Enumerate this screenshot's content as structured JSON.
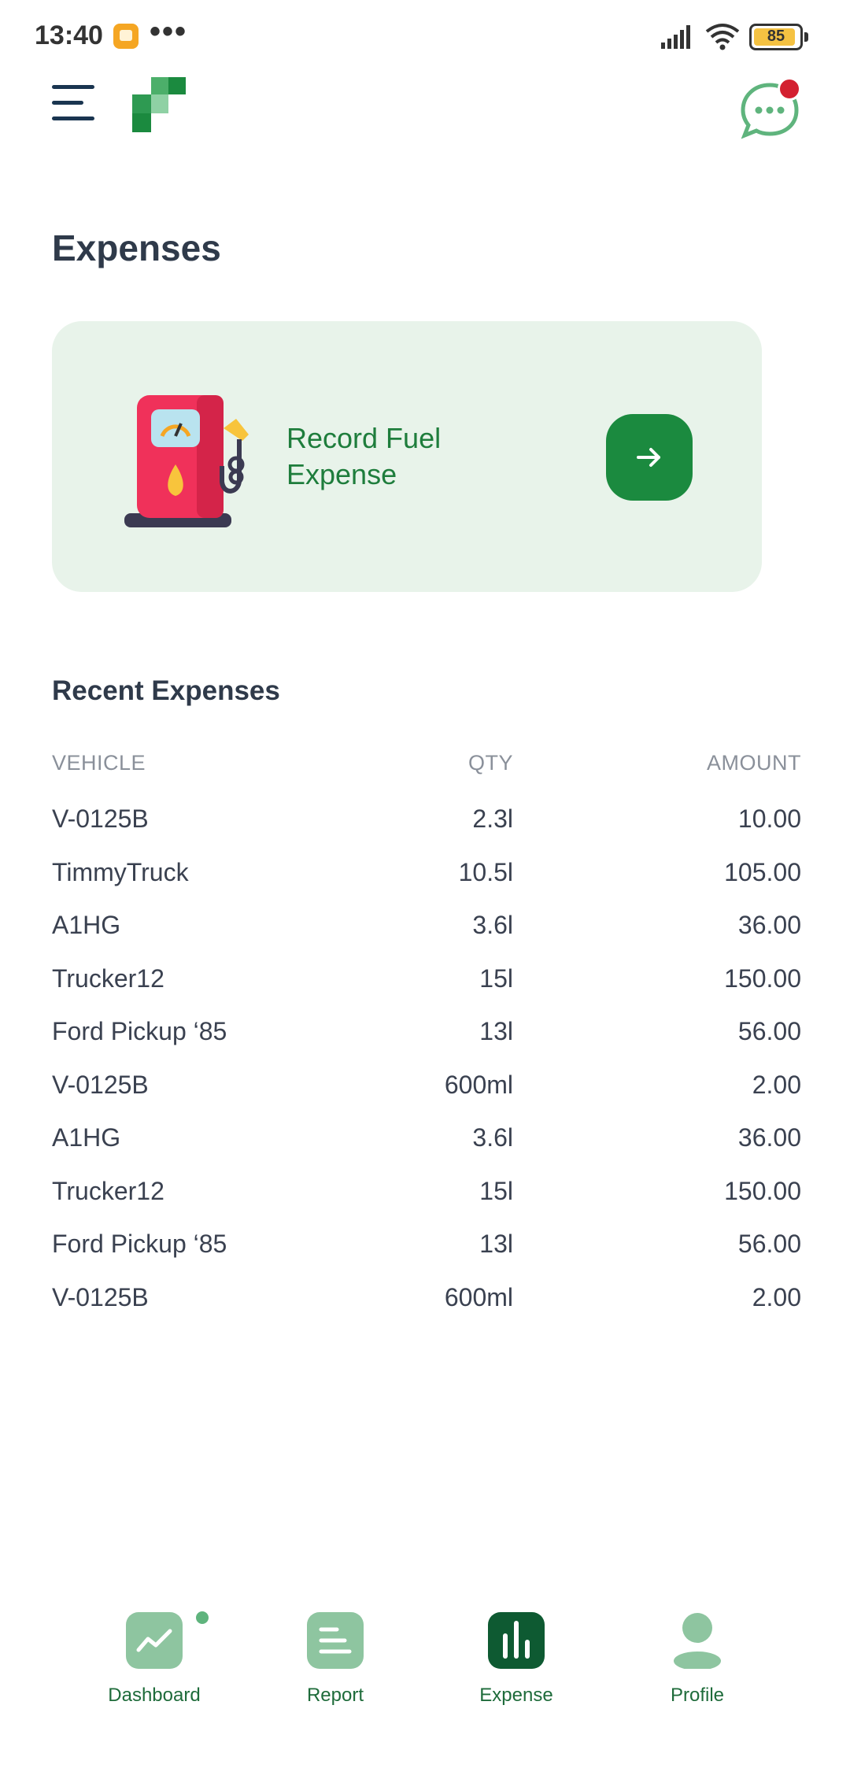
{
  "status_bar": {
    "time": "13:40",
    "dots": "•••",
    "battery": "85"
  },
  "header": {
    "menu_icon": "menu-icon",
    "logo_icon": "logo-icon",
    "chat_icon": "chat-icon",
    "brand_color": "#1b8a3f",
    "notification_color": "#d32030"
  },
  "page": {
    "title": "Expenses"
  },
  "fuel_card": {
    "label": "Record Fuel Expense",
    "illustration": "fuel-pump-icon",
    "button_icon": "arrow-right-icon",
    "background": "#e8f3ea"
  },
  "recent": {
    "title": "Recent Expenses",
    "columns": {
      "vehicle": "VEHICLE",
      "qty": "QTY",
      "amount": "AMOUNT"
    },
    "rows": [
      {
        "vehicle": "V-0125B",
        "qty": "2.3l",
        "amount": "10.00"
      },
      {
        "vehicle": "TimmyTruck",
        "qty": "10.5l",
        "amount": "105.00"
      },
      {
        "vehicle": "A1HG",
        "qty": "3.6l",
        "amount": "36.00"
      },
      {
        "vehicle": "Trucker12",
        "qty": "15l",
        "amount": "150.00"
      },
      {
        "vehicle": "Ford Pickup ‘85",
        "qty": "13l",
        "amount": "56.00"
      },
      {
        "vehicle": "V-0125B",
        "qty": "600ml",
        "amount": "2.00"
      },
      {
        "vehicle": "A1HG",
        "qty": "3.6l",
        "amount": "36.00"
      },
      {
        "vehicle": "Trucker12",
        "qty": "15l",
        "amount": "150.00"
      },
      {
        "vehicle": "Ford Pickup ‘85",
        "qty": "13l",
        "amount": "56.00"
      },
      {
        "vehicle": "V-0125B",
        "qty": "600ml",
        "amount": "2.00"
      }
    ]
  },
  "bottom_nav": {
    "items": [
      {
        "label": "Dashboard",
        "icon": "dashboard-icon",
        "active": false
      },
      {
        "label": "Report",
        "icon": "report-icon",
        "active": false
      },
      {
        "label": "Expense",
        "icon": "expense-icon",
        "active": true
      },
      {
        "label": "Profile",
        "icon": "profile-icon",
        "active": false
      }
    ]
  }
}
